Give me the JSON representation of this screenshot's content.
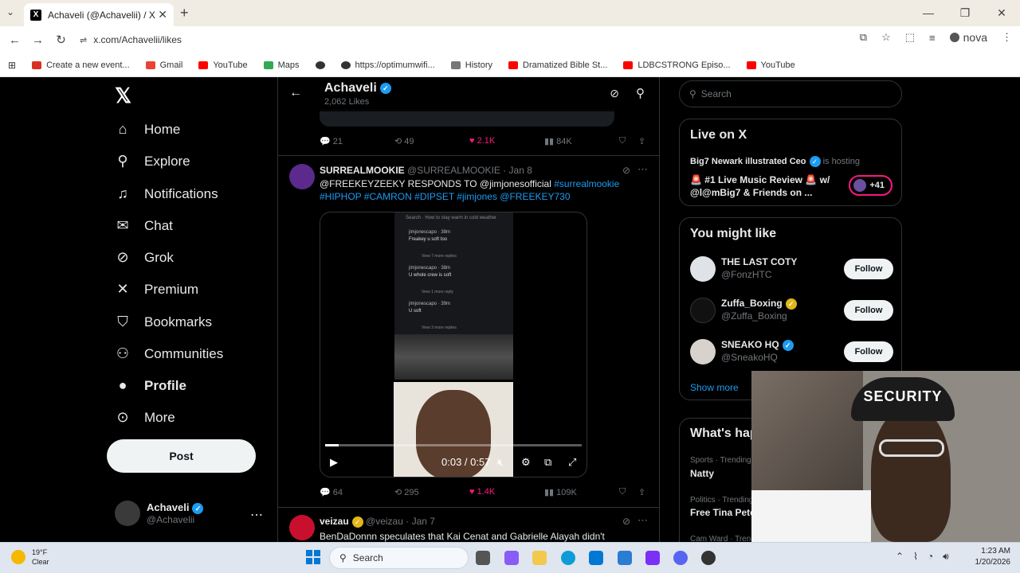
{
  "browser": {
    "tab_title": "Achaveli (@Achavelii) / X",
    "tab_logo": "X",
    "url": "x.com/Achavelii/likes",
    "profile_name": "nova",
    "bookmarks": [
      {
        "label": "Create a new event...",
        "color": "#d93025"
      },
      {
        "label": "Gmail",
        "color": "#ea4335"
      },
      {
        "label": "YouTube",
        "color": "#ff0000"
      },
      {
        "label": "Maps",
        "color": "#34a853"
      },
      {
        "label": "",
        "color": "#333333"
      },
      {
        "label": "https://optimumwifi...",
        "color": "#333333"
      },
      {
        "label": "History",
        "color": "#777777"
      },
      {
        "label": "Dramatized Bible St...",
        "color": "#ff0000"
      },
      {
        "label": "LDBCSTRONG Episo...",
        "color": "#ff0000"
      },
      {
        "label": "YouTube",
        "color": "#ff0000"
      }
    ]
  },
  "nav": {
    "items": [
      {
        "label": "Home",
        "icon": "home-icon",
        "glyph": "⌂"
      },
      {
        "label": "Explore",
        "icon": "search-icon",
        "glyph": "⚲"
      },
      {
        "label": "Notifications",
        "icon": "bell-icon",
        "glyph": "🔔"
      },
      {
        "label": "Chat",
        "icon": "mail-icon",
        "glyph": "✉"
      },
      {
        "label": "Grok",
        "icon": "grok-icon",
        "glyph": "⊘"
      },
      {
        "label": "Premium",
        "icon": "x-premium-icon",
        "glyph": "𝕏"
      },
      {
        "label": "Bookmarks",
        "icon": "bookmark-icon",
        "glyph": "⛉"
      },
      {
        "label": "Communities",
        "icon": "people-icon",
        "glyph": "👥"
      },
      {
        "label": "Profile",
        "icon": "person-icon",
        "glyph": "👤"
      },
      {
        "label": "More",
        "icon": "more-circle-icon",
        "glyph": "⋯"
      }
    ],
    "post_label": "Post",
    "me_name": "Achaveli",
    "me_handle": "@Achavelii"
  },
  "header": {
    "name": "Achaveli",
    "likes": "2,062 Likes"
  },
  "prev_tweet": {
    "replies": "21",
    "reposts": "49",
    "likes": "2.1K",
    "views": "84K"
  },
  "tweet1": {
    "name": "SURREALMOOKIE",
    "handle": "@SURREALMOOKIE · Jan 8",
    "text_a": "@FREEKEYZEEKY RESPONDS TO @jimjonesofficial ",
    "tag_a": "#surrealmookie",
    "tags_b": "#HIPHOP #CAMRON #DIPSET #jimjones @FREEKEY730",
    "video_time": "0:03 / 0:57",
    "video_progress": 0.053,
    "replies": "64",
    "reposts": "295",
    "likes": "1.4K",
    "views": "109K",
    "video_lines": [
      "Search · How to stay warm in cold weather",
      "jimjonescapo · 38m",
      "Freakey u soft too",
      "View 7 more replies",
      "jimjonescapo · 38m",
      "U whole crew is soft",
      "View 1 more reply",
      "jimjonescapo · 39m",
      "U soft",
      "View 3 more replies"
    ]
  },
  "tweet2": {
    "name": "veizau",
    "handle": "@veizau · Jan 7",
    "text": "BenDaDonnn speculates that Kai Cenat and Gabrielle Alayah didn't"
  },
  "search_placeholder": "Search",
  "live": {
    "title": "Live on X",
    "host_name": "Big7 Newark illustrated Ceo",
    "host_suffix": "is hosting",
    "space_title": "🚨 #1 Live Music Review 🚨 w/ @l@mBig7 & Friends on ...",
    "listeners": "+41"
  },
  "wtf": {
    "title": "You might like",
    "follow_label": "Follow",
    "show_more": "Show more",
    "accounts": [
      {
        "name": "THE LAST COTY",
        "handle": "@FonzHTC",
        "color": "#dfe3e8"
      },
      {
        "name": "Zuffa_Boxing",
        "handle": "@Zuffa_Boxing",
        "color": "#111111"
      },
      {
        "name": "SNEAKO HQ",
        "handle": "@SneakoHQ",
        "color": "#d8d2cc"
      }
    ]
  },
  "trending": {
    "title": "What's happening",
    "items": [
      {
        "category": "Sports · Trending",
        "name": "Natty"
      },
      {
        "category": "Politics · Trending",
        "name": "Free Tina Peters"
      },
      {
        "category": "Cam Ward · Trending",
        "name": ""
      }
    ]
  },
  "webcam": {
    "cap_text": "SECURITY"
  },
  "taskbar": {
    "temp": "19°F",
    "condition": "Clear",
    "search_label": "Search",
    "time": "1:23 AM",
    "date": "1/20/2026"
  },
  "colors": {
    "accent": "#1d9bf0",
    "like": "#f91880",
    "background": "#000000"
  }
}
